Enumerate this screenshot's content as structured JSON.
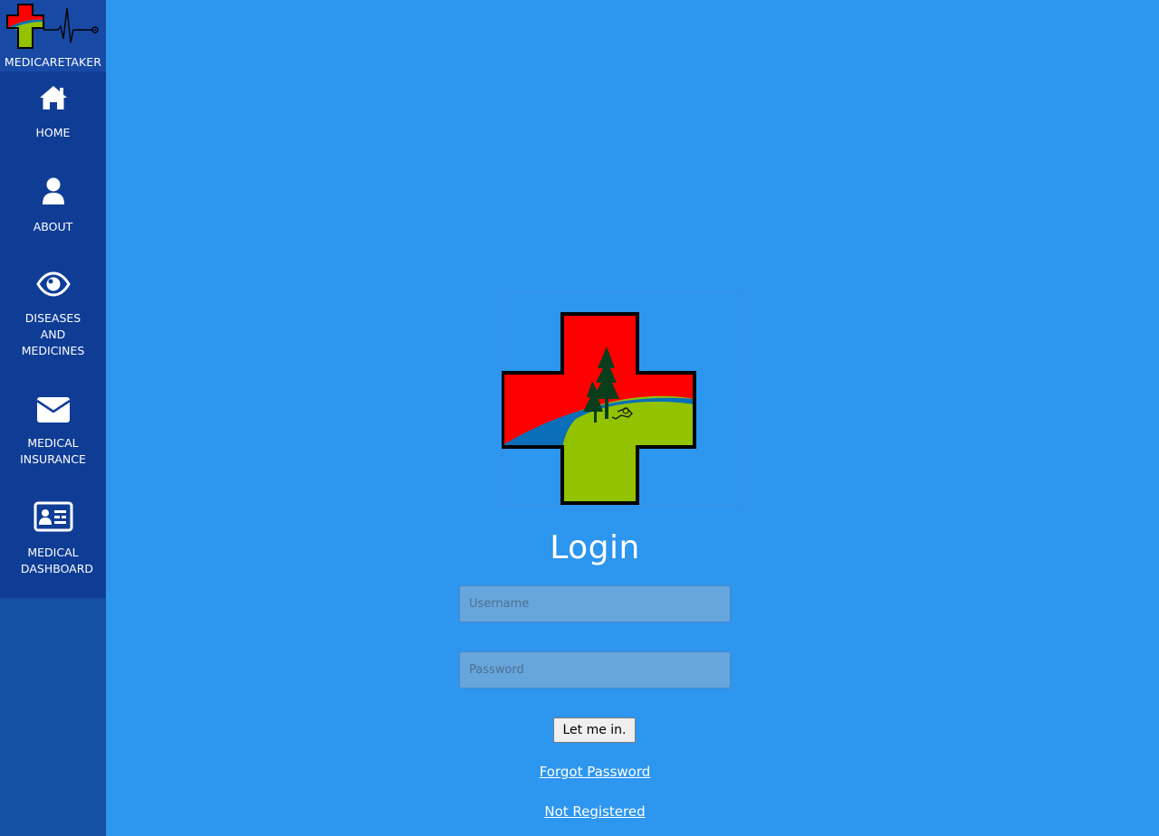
{
  "brand": {
    "name": "MEDICARETAKER"
  },
  "sidebar": {
    "items": [
      {
        "label": "HOME",
        "icon": "home-icon"
      },
      {
        "label": "ABOUT",
        "icon": "user-icon"
      },
      {
        "label_lines": [
          "DISEASES",
          "AND",
          "MEDICINES"
        ],
        "icon": "eye-icon"
      },
      {
        "label_lines": [
          "MEDICAL",
          "INSURANCE"
        ],
        "icon": "envelope-icon"
      },
      {
        "label_lines": [
          "MEDICAL",
          "DASHBOARD"
        ],
        "icon": "id-card-icon"
      }
    ]
  },
  "login": {
    "title": "Login",
    "username_placeholder": "Username",
    "password_placeholder": "Password",
    "submit_label": "Let me in.",
    "forgot_label": "Forgot Password",
    "register_label": "Not Registered"
  },
  "colors": {
    "background": "#2d96ef",
    "sidebar": "#0f3d96",
    "sidebar_lower": "#1450a3",
    "cross_red": "#ff0000",
    "cross_green": "#92c200",
    "cross_blue": "#0a6fb8"
  }
}
